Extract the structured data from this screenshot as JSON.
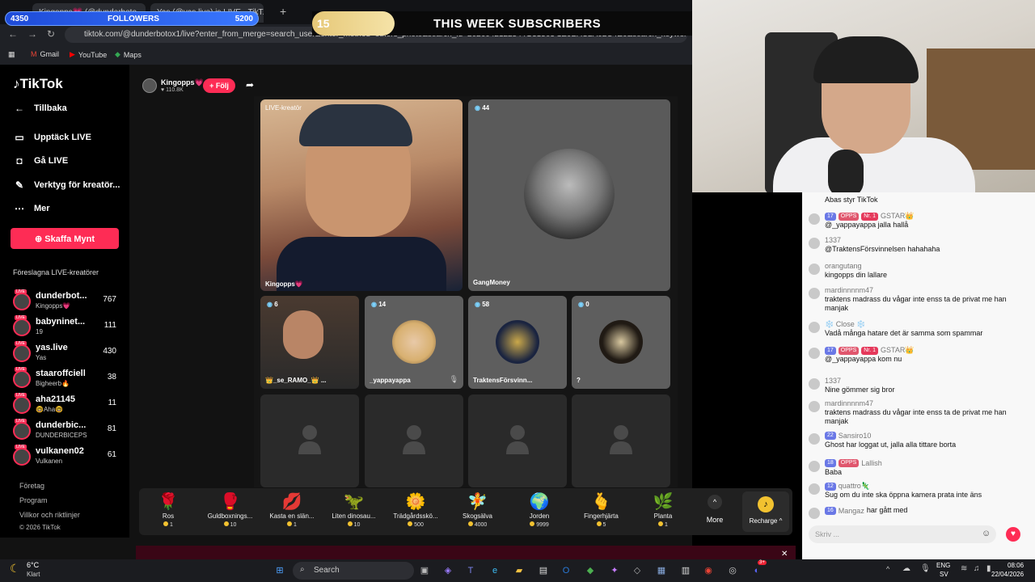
{
  "browser": {
    "tabs": [
      {
        "label": "Kingopps💗 (@dunderboto..."
      },
      {
        "label": "Yas (@yas.live) is LIVE - TikT..."
      }
    ],
    "new_tab_icon": "plus-icon",
    "url": "tiktok.com/@dunderbotox1/live?enter_from_merge=search_user&enter_method=others_photo&search_id=2026042122544G31563 1E9BAC2A02C4E6&search_keyword=king%20opps",
    "bookmarks": [
      "Gmail",
      "YouTube",
      "Maps"
    ]
  },
  "overlay": {
    "followers_current": "4350",
    "followers_label": "FOLLOWERS",
    "followers_goal": "5200",
    "subscribers_count": "15",
    "subscribers_title": "THIS WEEK SUBSCRIBERS"
  },
  "sidebar": {
    "logo": "TikTok",
    "nav": [
      {
        "label": "Tillbaka",
        "icon": "arrow-left-icon"
      },
      {
        "label": "Upptäck LIVE",
        "icon": "live-tv-icon"
      },
      {
        "label": "Gå LIVE",
        "icon": "camera-icon"
      },
      {
        "label": "Verktyg för kreatör...",
        "icon": "tools-icon"
      },
      {
        "label": "Mer",
        "icon": "more-dots-icon"
      }
    ],
    "coins_button": "Skaffa Mynt",
    "suggested_title": "Föreslagna LIVE-kreatörer",
    "creators": [
      {
        "name": "dunderbot...",
        "sub": "Kingopps💗",
        "count": "767"
      },
      {
        "name": "babyninet...",
        "sub": "19",
        "count": "111"
      },
      {
        "name": "yas.live",
        "sub": "Yas",
        "count": "430"
      },
      {
        "name": "staaroffciell",
        "sub": "Bigheerb🔥",
        "count": "38"
      },
      {
        "name": "aha21145",
        "sub": "🤓Aha🤓",
        "count": "11"
      },
      {
        "name": "dunderbic...",
        "sub": "DUNDERBICEPS",
        "count": "81"
      },
      {
        "name": "vulkanen02",
        "sub": "Vulkanen",
        "count": "61"
      }
    ],
    "live_badge": "LIVE",
    "footer": [
      "Företag",
      "Program",
      "Villkor och riktlinjer",
      "© 2026 TikTok"
    ]
  },
  "host": {
    "name": "Kingopps💗",
    "likes": "110.8K",
    "follow_label": "+ Följ"
  },
  "stage": {
    "main_tag": "LIVE-kreatör",
    "main_name": "Kingopps💗",
    "guest_main": {
      "name": "GangMoney",
      "count": "44"
    },
    "guests": [
      {
        "name": "👑_se_RAMO_👑 ...",
        "count": "6"
      },
      {
        "name": "_yappayappa",
        "count": "14"
      },
      {
        "name": "TraktensFörsvinn...",
        "count": "58"
      },
      {
        "name": "?",
        "count": "0"
      }
    ]
  },
  "gifts": [
    {
      "name": "Ros",
      "price": "1",
      "icon": "rose-icon",
      "emoji": "🌹"
    },
    {
      "name": "Guldboxnings...",
      "price": "10",
      "icon": "boxing-glove-icon",
      "emoji": "🥊"
    },
    {
      "name": "Kasta en slän...",
      "price": "1",
      "icon": "kiss-icon",
      "emoji": "💋"
    },
    {
      "name": "Liten dinosau...",
      "price": "10",
      "icon": "dino-icon",
      "emoji": "🦖"
    },
    {
      "name": "Trädgårdsskö...",
      "price": "500",
      "icon": "flower-icon",
      "emoji": "🌼"
    },
    {
      "name": "Skogsälva",
      "price": "4000",
      "icon": "fairy-icon",
      "emoji": "🧚"
    },
    {
      "name": "Jorden",
      "price": "9999",
      "icon": "earth-icon",
      "emoji": "🌍"
    },
    {
      "name": "Fingerhjärta",
      "price": "5",
      "icon": "finger-heart-icon",
      "emoji": "🫰"
    },
    {
      "name": "Planta",
      "price": "1",
      "icon": "plant-icon",
      "emoji": "🌿"
    }
  ],
  "gift_more": "More",
  "recharge": "Recharge ^",
  "chat": {
    "messages": [
      {
        "user": "",
        "text": "Abas styr TikTok",
        "badges": []
      },
      {
        "user": "GSTAR👑",
        "text": "@_yappayappa jalla hallå",
        "badges": [
          "17",
          "OPPS",
          "Nr. 1"
        ]
      },
      {
        "user": "1337",
        "text": "@TraktensFörsvinnelsen hahahaha",
        "badges": []
      },
      {
        "user": "orangutang",
        "text": "kingopps din lallare",
        "badges": []
      },
      {
        "user": "mardinnnnm47",
        "text": "traktens madrass du vågar inte enss ta de privat me han manjak",
        "badges": []
      },
      {
        "user": "❄️ Close ❄️",
        "text": "Vadå många hatare det är samma som spammar",
        "badges": []
      },
      {
        "user": "GSTAR👑",
        "text": "@_yappayappa kom nu",
        "badges": [
          "17",
          "OPPS",
          "Nr. 1"
        ]
      },
      {
        "user": "1337",
        "text": "Nine gömmer sig bror",
        "badges": []
      },
      {
        "user": "mardinnnnm47",
        "text": "traktens madrass du vågar inte enss ta de privat me han manjak",
        "badges": []
      },
      {
        "user": "Sansiro10",
        "text": "Ghost har loggat ut, jalla alla tittare borta",
        "badges": [
          "22"
        ]
      },
      {
        "user": "Lallish",
        "text": "Baba",
        "badges": [
          "18",
          "OPPS"
        ]
      },
      {
        "user": "quattro🦎",
        "text": "Sug om du inte ska öppna kamera prata inte äns",
        "badges": [
          "12"
        ]
      },
      {
        "user": "Mangaz",
        "text": "har gått med",
        "badges": [
          "16"
        ]
      }
    ],
    "input_placeholder": "Skriv ..."
  },
  "taskbar": {
    "weather_temp": "6°C",
    "weather_desc": "Klart",
    "search": "Search",
    "lang": "ENG",
    "lang2": "SV",
    "time": "08:06",
    "date": "22/04/2026",
    "notif_count": "3+"
  },
  "colors": {
    "brand": "#fe2c55",
    "chat_bg": "#f8f8f8",
    "followers_bar": "#2f6cf0",
    "subs_pill": "#e9cf85"
  }
}
